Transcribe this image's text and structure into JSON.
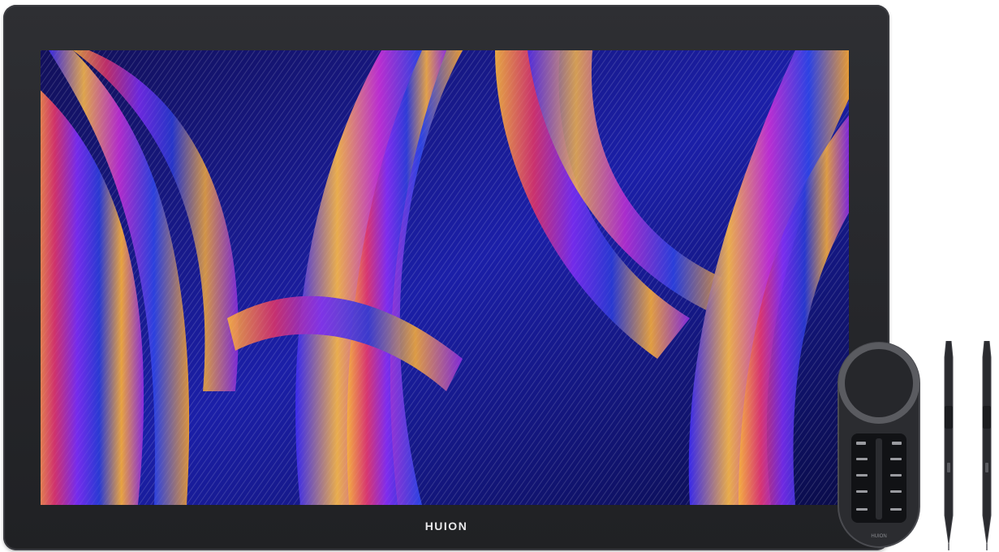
{
  "device": {
    "brand_logo": "HUION",
    "remote_logo": "HUION"
  },
  "colors": {
    "bezel": "#2a2b2f",
    "screen_base": "#0b0a3a",
    "swirl_gold": "#f2a93b",
    "swirl_purple": "#7a2cf0",
    "swirl_blue": "#2a3bd6",
    "swirl_magenta": "#d9336a"
  }
}
